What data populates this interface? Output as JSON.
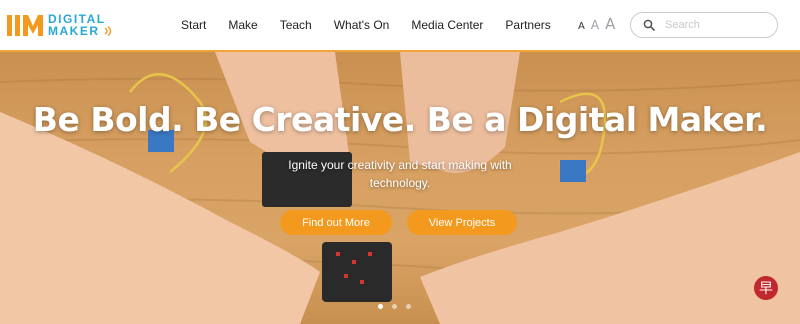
{
  "logo": {
    "line1": "DIGITAL",
    "line2": "MAKER",
    "mark_icon": "im-logo-mark",
    "colors": {
      "mark": "#f39a1e",
      "text": "#2aa7d5"
    }
  },
  "nav": {
    "items": [
      {
        "label": "Start"
      },
      {
        "label": "Make"
      },
      {
        "label": "Teach"
      },
      {
        "label": "What's On"
      },
      {
        "label": "Media Center"
      },
      {
        "label": "Partners"
      }
    ]
  },
  "font_sizer": {
    "small": "A",
    "medium": "A",
    "large": "A"
  },
  "search": {
    "placeholder": "Search",
    "value": "",
    "icon": "search-icon"
  },
  "hero": {
    "title": "Be Bold. Be Creative. Be a Digital Maker.",
    "subtitle": "Ignite your creativity and start making with technology.",
    "buttons": {
      "find_out_more": "Find out More",
      "view_projects": "View Projects"
    },
    "carousel": {
      "slide_count": 3,
      "active_index": 0
    }
  },
  "watermark": {
    "glyph": "早"
  },
  "colors": {
    "accent": "#f39a1e",
    "header_border": "#f0a43a",
    "brand_blue": "#2aa7d5"
  }
}
